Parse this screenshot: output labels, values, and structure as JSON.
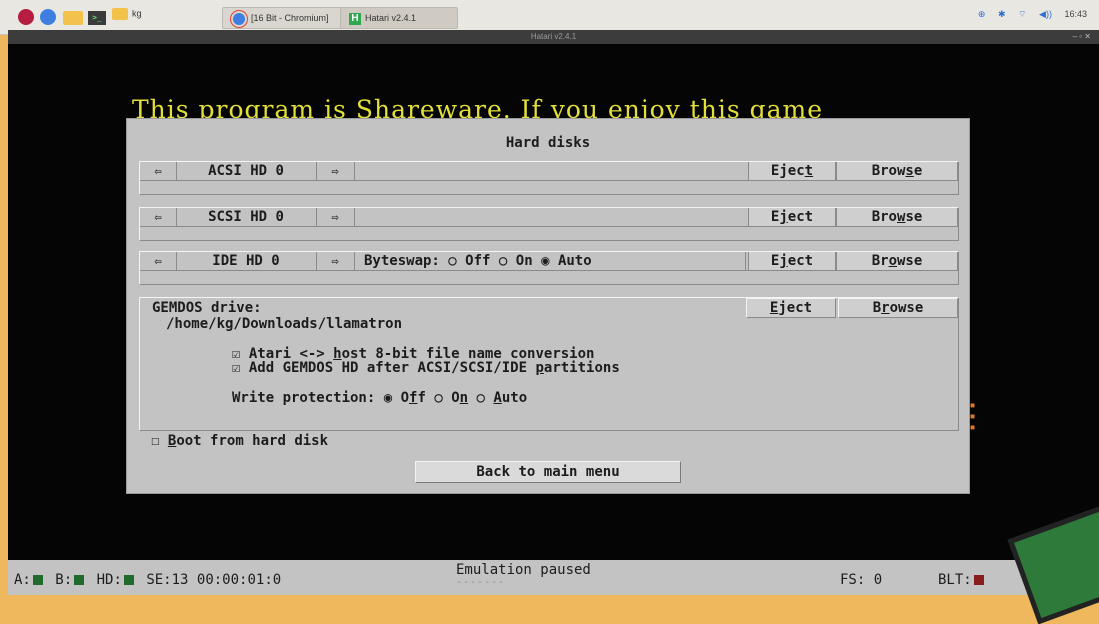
{
  "taskbar": {
    "folder_label": "kg",
    "tasks": [
      {
        "label": "[16 Bit - Chromium]"
      },
      {
        "label": "Hatari v2.4.1"
      }
    ],
    "clock": "16:43"
  },
  "window": {
    "title": "Hatari v2.4.1",
    "controls": "– ▫ ✕"
  },
  "game": {
    "banner": "This program is Shareware. If you enjoy this game"
  },
  "dialog": {
    "title": "Hard disks",
    "left_arrow": "⇦",
    "right_arrow": "⇨",
    "acsi": {
      "name": "ACSI HD 0",
      "eject_pre": "Ejec",
      "eject_u": "t",
      "eject_post": "",
      "browse_pre": "Brow",
      "browse_u": "s",
      "browse_post": "e"
    },
    "scsi": {
      "name": "SCSI HD 0",
      "eject_pre": "E",
      "eject_u": "j",
      "eject_post": "ect",
      "browse_pre": "Bro",
      "browse_u": "w",
      "browse_post": "se"
    },
    "ide": {
      "name": "IDE HD 0",
      "byteswap_label": "Byteswap:",
      "off_mark": "○",
      "off_label": "Off",
      "on_mark": "○",
      "on_label": "On",
      "auto_mark": "◉",
      "auto_label": "Auto",
      "eject_pre": "E",
      "eject_u": "j",
      "eject_post": "ect",
      "browse_pre": "Br",
      "browse_u": "o",
      "browse_post": "wse"
    },
    "gemdos": {
      "label": "GEMDOS drive:",
      "path": "/home/kg/Downloads/llamatron",
      "eject_pre": "",
      "eject_u": "E",
      "eject_post": "ject",
      "browse_pre": "B",
      "browse_u": "r",
      "browse_post": "owse",
      "opt1_mark": "☑",
      "opt1_pre": "Atari <-> ",
      "opt1_u": "h",
      "opt1_post": "ost 8-bit file name conversion",
      "opt2_mark": "☑",
      "opt2_pre": "Add GEMDOS HD after ACSI/SCSI/IDE ",
      "opt2_u": "p",
      "opt2_post": "artitions",
      "wp_label": "Write protection:",
      "wp_off_mark": "◉",
      "wp_off_pre": "O",
      "wp_off_u": "f",
      "wp_off_post": "f",
      "wp_on_mark": "○",
      "wp_on_pre": "O",
      "wp_on_u": "n",
      "wp_auto_mark": "○",
      "wp_auto_u": "A",
      "wp_auto_post": "uto"
    },
    "boot": {
      "mark": "☐",
      "u": "B",
      "post": "oot from hard disk"
    },
    "back_label": "Back to main menu"
  },
  "statusbar": {
    "a_label": "A:",
    "b_label": "B:",
    "hd_label": "HD:",
    "se_time": "SE:13 00:00:01:0",
    "message": "Emulation paused",
    "dash": "-------",
    "fs": "FS: 0",
    "blt": "BLT:"
  }
}
